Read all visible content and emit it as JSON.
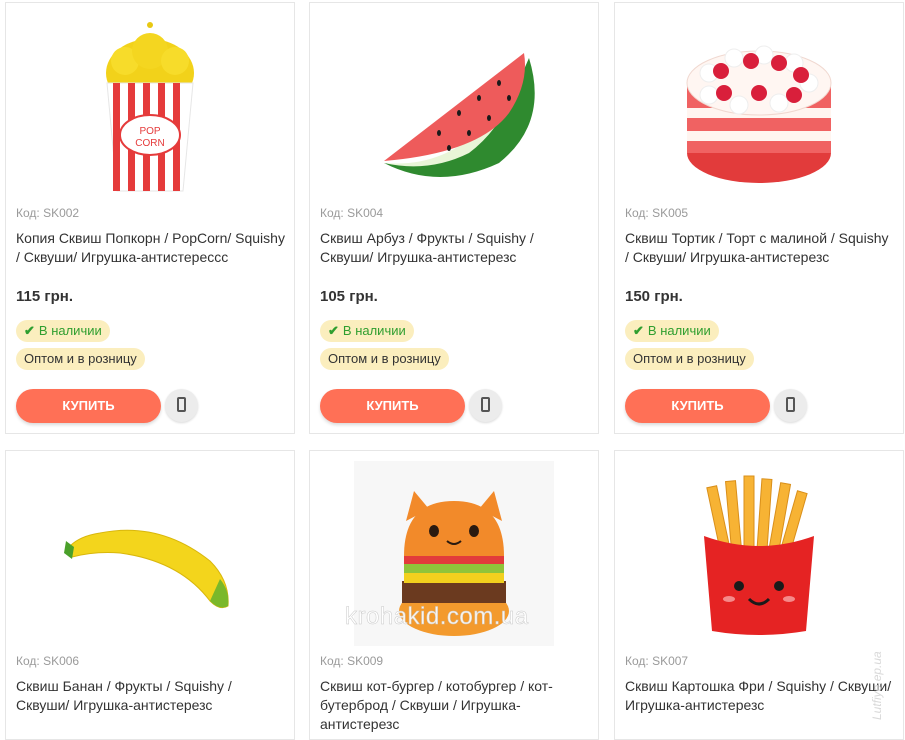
{
  "products": [
    {
      "code": "Код: SK002",
      "title": "Копия Сквиш Попкорн / PopCorn/ Squishy / Сквуши/ Игрушка-антистерессс",
      "price": "115 грн.",
      "image": "popcorn-image",
      "stock": "В наличии",
      "wholesale": "Оптом и в розницу",
      "buy": "КУПИТЬ"
    },
    {
      "code": "Код: SK004",
      "title": "Сквиш Арбуз / Фрукты / Squishy / Сквуши/ Игрушка-антистерезс",
      "price": "105 грн.",
      "image": "watermelon-image",
      "stock": "В наличии",
      "wholesale": "Оптом и в розницу",
      "buy": "КУПИТЬ"
    },
    {
      "code": "Код: SK005",
      "title": "Сквиш Тортик / Торт с малиной / Squishy / Сквуши/ Игрушка-антистерезс",
      "price": "150 грн.",
      "image": "cake-image",
      "stock": "В наличии",
      "wholesale": "Оптом и в розницу",
      "buy": "КУПИТЬ"
    },
    {
      "code": "Код: SK006",
      "title": "Сквиш Банан / Фрукты / Squishy / Сквуши/ Игрушка-антистерезс",
      "image": "banana-image"
    },
    {
      "code": "Код: SK009",
      "title": "Сквиш кот-бургер / котобургер / кот-бутерброд / Сквуши / Игрушка-антистерезс",
      "image": "cat-burger-image"
    },
    {
      "code": "Код: SK007",
      "title": "Сквиш Картошка Фри / Squishy / Сквуши/ Игрушка-антистерезс",
      "image": "fries-image"
    }
  ],
  "watermark": "krohakid.com.ua",
  "side_watermark": "Lutfiye.ep.ua",
  "colors": {
    "buy_button": "#ff7056",
    "badge_bg": "#fbeebe",
    "in_stock": "#2f9e2f"
  }
}
